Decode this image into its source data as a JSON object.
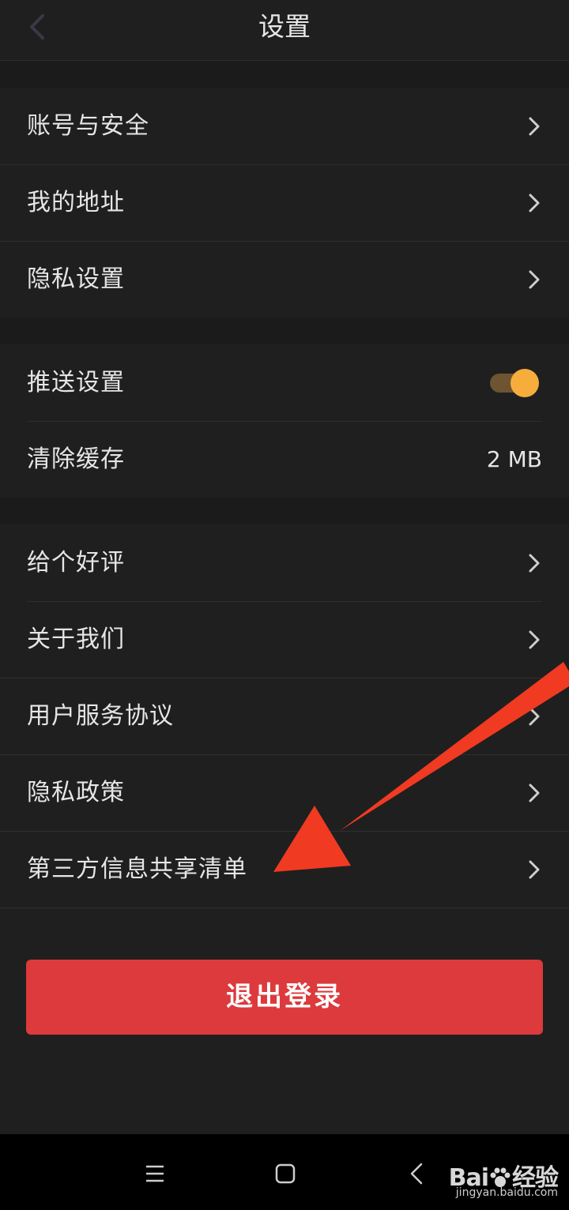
{
  "header": {
    "title": "设置",
    "back_icon": "chevron-left-icon"
  },
  "groups": [
    {
      "items": [
        {
          "label": "账号与安全",
          "icon": "chevron-right-icon"
        },
        {
          "label": "我的地址",
          "icon": "chevron-right-icon"
        },
        {
          "label": "隐私设置",
          "icon": "chevron-right-icon"
        }
      ]
    },
    {
      "items": [
        {
          "label": "推送设置",
          "toggle_on": true
        },
        {
          "label": "清除缓存",
          "value": "2 MB"
        }
      ]
    },
    {
      "items": [
        {
          "label": "给个好评",
          "icon": "chevron-right-icon"
        },
        {
          "label": "关于我们",
          "icon": "chevron-right-icon"
        },
        {
          "label": "用户服务协议",
          "icon": "chevron-right-icon"
        },
        {
          "label": "隐私政策",
          "icon": "chevron-right-icon"
        },
        {
          "label": "第三方信息共享清单",
          "icon": "chevron-right-icon"
        }
      ]
    }
  ],
  "logout_label": "退出登录",
  "nav": {
    "menu_icon": "menu-icon",
    "home_icon": "square-home-icon",
    "back_icon": "back-icon"
  },
  "watermark": {
    "brand_left": "Bai",
    "brand_right": "经验",
    "url": "jingyan.baidu.com"
  },
  "colors": {
    "accent": "#f6ad3c",
    "logout": "#dc3a3c",
    "arrow": "#f03a22"
  }
}
